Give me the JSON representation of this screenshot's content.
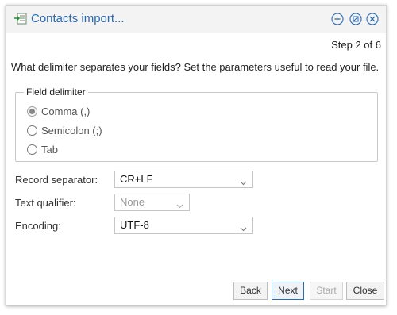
{
  "window": {
    "title": "Contacts import...",
    "icon": "import-icon",
    "controls": [
      "minimize-icon",
      "maximize-icon",
      "close-icon"
    ]
  },
  "wizard": {
    "step": "Step 2 of 6",
    "instructions": "What delimiter separates your fields? Set the parameters useful to read your file."
  },
  "field_delimiter": {
    "legend": "Field delimiter",
    "options": [
      {
        "label": "Comma (,)",
        "checked": true
      },
      {
        "label": "Semicolon (;)",
        "checked": false
      },
      {
        "label": "Tab",
        "checked": false
      }
    ]
  },
  "form": {
    "record_separator": {
      "label": "Record separator:",
      "value": "CR+LF"
    },
    "text_qualifier": {
      "label": "Text qualifier:",
      "value": "None",
      "disabled": true
    },
    "encoding": {
      "label": "Encoding:",
      "value": "UTF-8"
    }
  },
  "buttons": {
    "back": "Back",
    "next": "Next",
    "start": "Start",
    "close": "Close"
  },
  "colors": {
    "title": "#2a6bb0",
    "primary_border": "#2a6bb0"
  }
}
